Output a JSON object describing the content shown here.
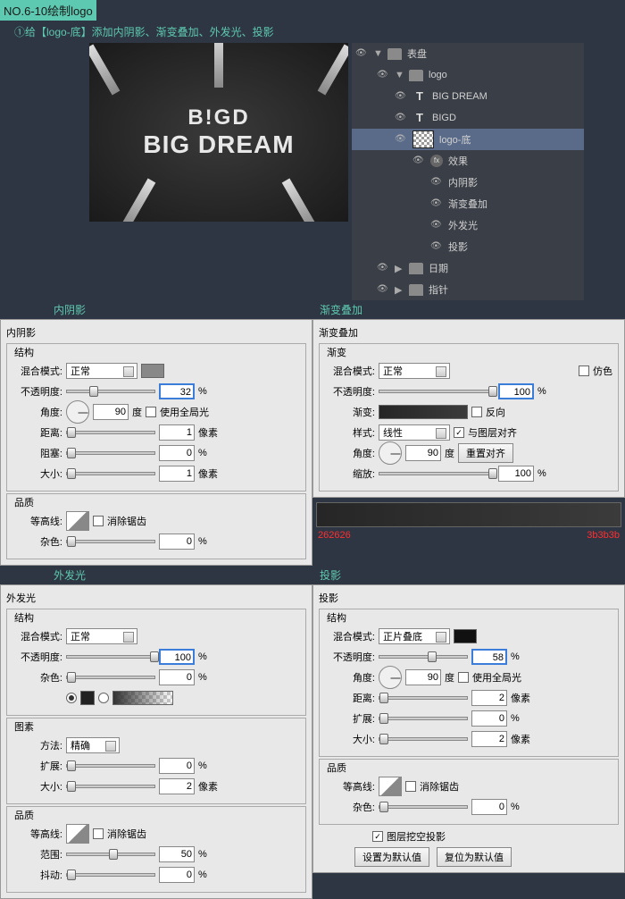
{
  "header": {
    "badge": "NO.6-10绘制logo",
    "instruction": "①给【logo-底】添加内阴影、渐变叠加、外发光、投影"
  },
  "preview": {
    "line1": "B!GD",
    "line2": "BIG DREAM"
  },
  "layers": {
    "group1": "表盘",
    "group2": "logo",
    "item1": "BIG DREAM",
    "item2": "BIGD",
    "item3": "logo-底",
    "fx": "效果",
    "fx1": "内阴影",
    "fx2": "渐变叠加",
    "fx3": "外发光",
    "fx4": "投影",
    "group3": "日期",
    "group4": "指针"
  },
  "sections": {
    "s1": "内阴影",
    "s2": "渐变叠加",
    "s3": "外发光",
    "s4": "投影"
  },
  "labels": {
    "struct": "结构",
    "blend": "混合模式:",
    "opacity": "不透明度:",
    "angle": "角度:",
    "distance": "距离:",
    "choke": "阻塞:",
    "size": "大小:",
    "quality": "品质",
    "contour": "等高线:",
    "antialias": "消除锯齿",
    "noise": "杂色:",
    "degree": "度",
    "useGlobal": "使用全局光",
    "pixel": "像素",
    "percent": "%",
    "dither": "仿色",
    "gradient": "渐变:",
    "reverse": "反向",
    "style": "样式:",
    "alignLayer": "与图层对齐",
    "resetAlign": "重置对齐",
    "scale": "缩放:",
    "elements": "图素",
    "method": "方法:",
    "spread": "扩展:",
    "range": "范围:",
    "jitter": "抖动:",
    "knockout": "图层挖空投影",
    "setDefault": "设置为默认值",
    "resetDefault": "复位为默认值"
  },
  "values": {
    "normal": "正常",
    "multiply": "正片叠底",
    "linear": "线性",
    "precise": "精确",
    "is_opacity": "32",
    "is_angle": "90",
    "is_dist": "1",
    "is_choke": "0",
    "is_size": "1",
    "is_noise": "0",
    "go_opacity": "100",
    "go_angle": "90",
    "go_scale": "100",
    "og_opacity": "100",
    "og_noise": "0",
    "og_spread": "0",
    "og_size": "2",
    "og_range": "50",
    "og_jitter": "0",
    "ds_opacity": "58",
    "ds_angle": "90",
    "ds_dist": "2",
    "ds_spread": "0",
    "ds_size": "2",
    "ds_noise": "0"
  },
  "gradStops": {
    "left": "262626",
    "right": "3b3b3b"
  }
}
